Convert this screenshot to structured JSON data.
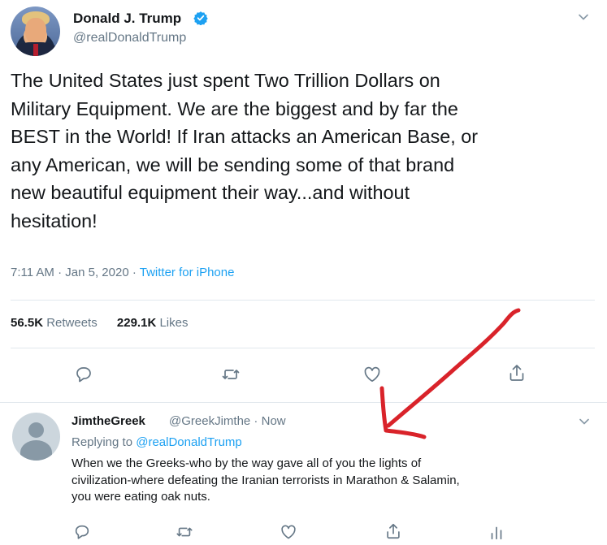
{
  "tweet": {
    "author_name": "Donald J. Trump",
    "author_handle": "@realDonaldTrump",
    "text": "The United States just spent Two Trillion Dollars on\nMilitary Equipment. We are the biggest and by far the\nBEST in the World! If Iran attacks an American Base, or\nany American, we will be sending some of that brand\nnew beautiful equipment their way...and without\nhesitation!",
    "time": "7:11 AM",
    "date": "Jan 5, 2020",
    "separator": " · ",
    "source": "Twitter for iPhone",
    "retweets_count": "56.5K",
    "retweets_label": " Retweets",
    "likes_count": "229.1K",
    "likes_label": " Likes"
  },
  "reply": {
    "author_name": "JimtheGreek",
    "author_handle": "@GreekJimthe",
    "time": "Now",
    "replying_label": "Replying to ",
    "replying_handle": "@realDonaldTrump",
    "text": "When we the Greeks-who by the way gave all of you the lights of\ncivilization-where defeating the Iranian terrorists in Marathon & Salamin,\nyou were eating oak nuts."
  },
  "icons": {
    "verified": "verified-badge-icon",
    "menu": "chevron-down-icon",
    "reply": "reply-icon",
    "retweet": "retweet-icon",
    "like": "heart-icon",
    "share": "share-icon",
    "analytics": "analytics-icon"
  },
  "colors": {
    "link": "#1da1f2",
    "secondary_text": "#657786",
    "annotation_arrow": "#d9232a"
  }
}
